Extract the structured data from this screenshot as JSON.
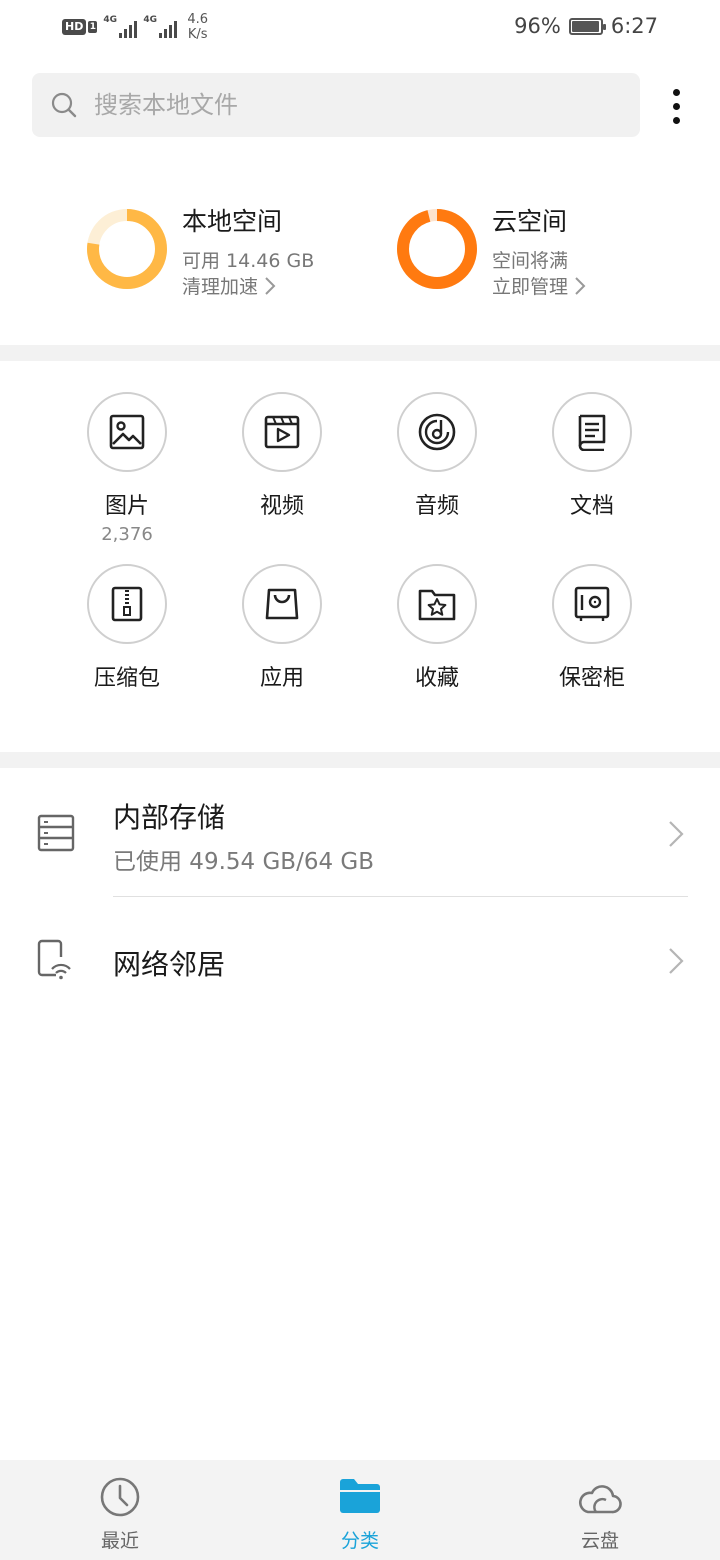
{
  "status_bar": {
    "hd": "HD",
    "sim": "1",
    "signal1_tag": "4G",
    "signal2_tag": "4G",
    "speed_value": "4.6",
    "speed_unit": "K/s",
    "battery_percent": "96%",
    "battery_level": 0.96,
    "time": "6:27"
  },
  "search": {
    "placeholder": "搜索本地文件",
    "value": ""
  },
  "storage": {
    "local": {
      "title": "本地空间",
      "available": "可用 14.46 GB",
      "action": "清理加速",
      "used_fraction": 0.774,
      "color": "#ffb845",
      "track_color": "#fdefd6"
    },
    "cloud": {
      "title": "云空间",
      "status": "空间将满",
      "action": "立即管理",
      "used_fraction": 0.96,
      "color": "#ff7a10",
      "track_color": "#fde4cf"
    }
  },
  "categories": [
    {
      "label": "图片",
      "count": "2,376",
      "icon": "image-icon"
    },
    {
      "label": "视频",
      "count": "",
      "icon": "video-icon"
    },
    {
      "label": "音频",
      "count": "",
      "icon": "audio-icon"
    },
    {
      "label": "文档",
      "count": "",
      "icon": "document-icon"
    },
    {
      "label": "压缩包",
      "count": "",
      "icon": "archive-icon"
    },
    {
      "label": "应用",
      "count": "",
      "icon": "app-bag-icon"
    },
    {
      "label": "收藏",
      "count": "",
      "icon": "favorites-folder-icon"
    },
    {
      "label": "保密柜",
      "count": "",
      "icon": "safe-icon"
    }
  ],
  "locations": [
    {
      "title": "内部存储",
      "subtitle": "已使用 49.54 GB/64 GB",
      "icon": "internal-storage-icon"
    },
    {
      "title": "网络邻居",
      "subtitle": "",
      "icon": "network-neighbor-icon"
    }
  ],
  "bottom_nav": [
    {
      "label": "最近",
      "icon": "clock-icon",
      "active": false
    },
    {
      "label": "分类",
      "icon": "folder-icon",
      "active": true
    },
    {
      "label": "云盘",
      "icon": "cloud-icon",
      "active": false
    }
  ],
  "colors": {
    "accent": "#1aa3d9",
    "inactive": "#666666"
  }
}
